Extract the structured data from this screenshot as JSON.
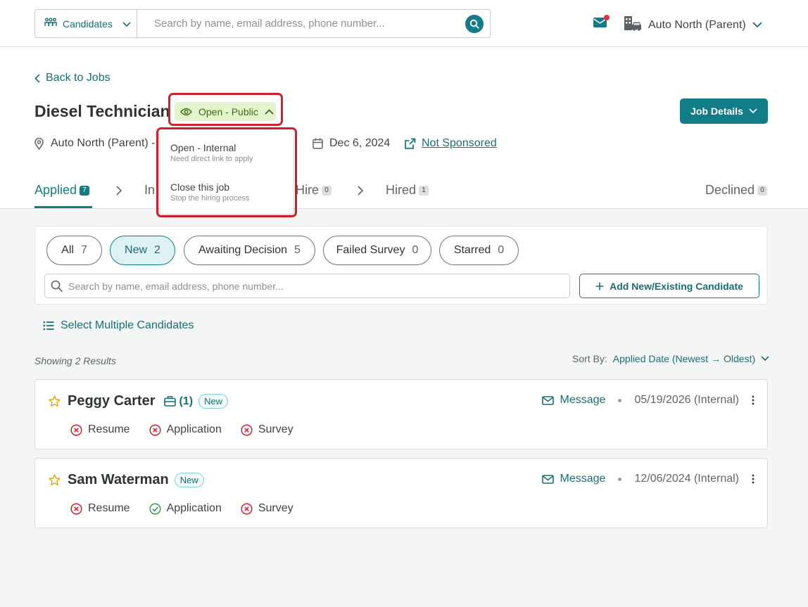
{
  "topbar": {
    "entity_label": "Candidates",
    "search_placeholder": "Search by name, email address, phone number...",
    "org_name": "Auto North (Parent)"
  },
  "job": {
    "back_label": "Back to Jobs",
    "title": "Diesel Technician",
    "status": "Open - Public",
    "location": "Auto North (Parent) - ",
    "date": "Dec 6, 2024",
    "sponsored": "Not Sponsored",
    "details_button": "Job Details"
  },
  "status_menu": [
    {
      "label": "Open - Internal",
      "sub": "Need direct link to apply"
    },
    {
      "label": "Close this job",
      "sub": "Stop the hiring process"
    }
  ],
  "stages": [
    {
      "label": "Applied",
      "count": "7"
    },
    {
      "label": "In",
      "count": ""
    },
    {
      "label": "Hire",
      "count": "0"
    },
    {
      "label": "Hired",
      "count": "1"
    },
    {
      "label": "Declined",
      "count": "0"
    }
  ],
  "filters": [
    {
      "label": "All",
      "count": "7"
    },
    {
      "label": "New",
      "count": "2"
    },
    {
      "label": "Awaiting Decision",
      "count": "5"
    },
    {
      "label": "Failed Survey",
      "count": "0"
    },
    {
      "label": "Starred",
      "count": "0"
    }
  ],
  "candidate_search_placeholder": "Search by name, email address, phone number...",
  "add_candidate_label": "Add New/Existing Candidate",
  "select_multiple_label": "Select Multiple Candidates",
  "showing": "Showing 2 Results",
  "sort": {
    "label": "Sort By:",
    "value": "Applied Date (Newest → Oldest)"
  },
  "candidates": [
    {
      "name": "Peggy Carter",
      "briefcase_count": "(1)",
      "badge": "New",
      "message_label": "Message",
      "date": "05/19/2026 (Internal)",
      "checks": [
        {
          "label": "Resume",
          "status": "fail"
        },
        {
          "label": "Application",
          "status": "fail"
        },
        {
          "label": "Survey",
          "status": "fail"
        }
      ]
    },
    {
      "name": "Sam Waterman",
      "badge": "New",
      "message_label": "Message",
      "date": "12/06/2024 (Internal)",
      "checks": [
        {
          "label": "Resume",
          "status": "fail"
        },
        {
          "label": "Application",
          "status": "pass"
        },
        {
          "label": "Survey",
          "status": "fail"
        }
      ]
    }
  ],
  "colors": {
    "accent": "#137d87",
    "status_bg": "#e4f4cc",
    "highlight": "#d0212e",
    "fail": "#d0212e",
    "pass": "#2e9e4f"
  }
}
